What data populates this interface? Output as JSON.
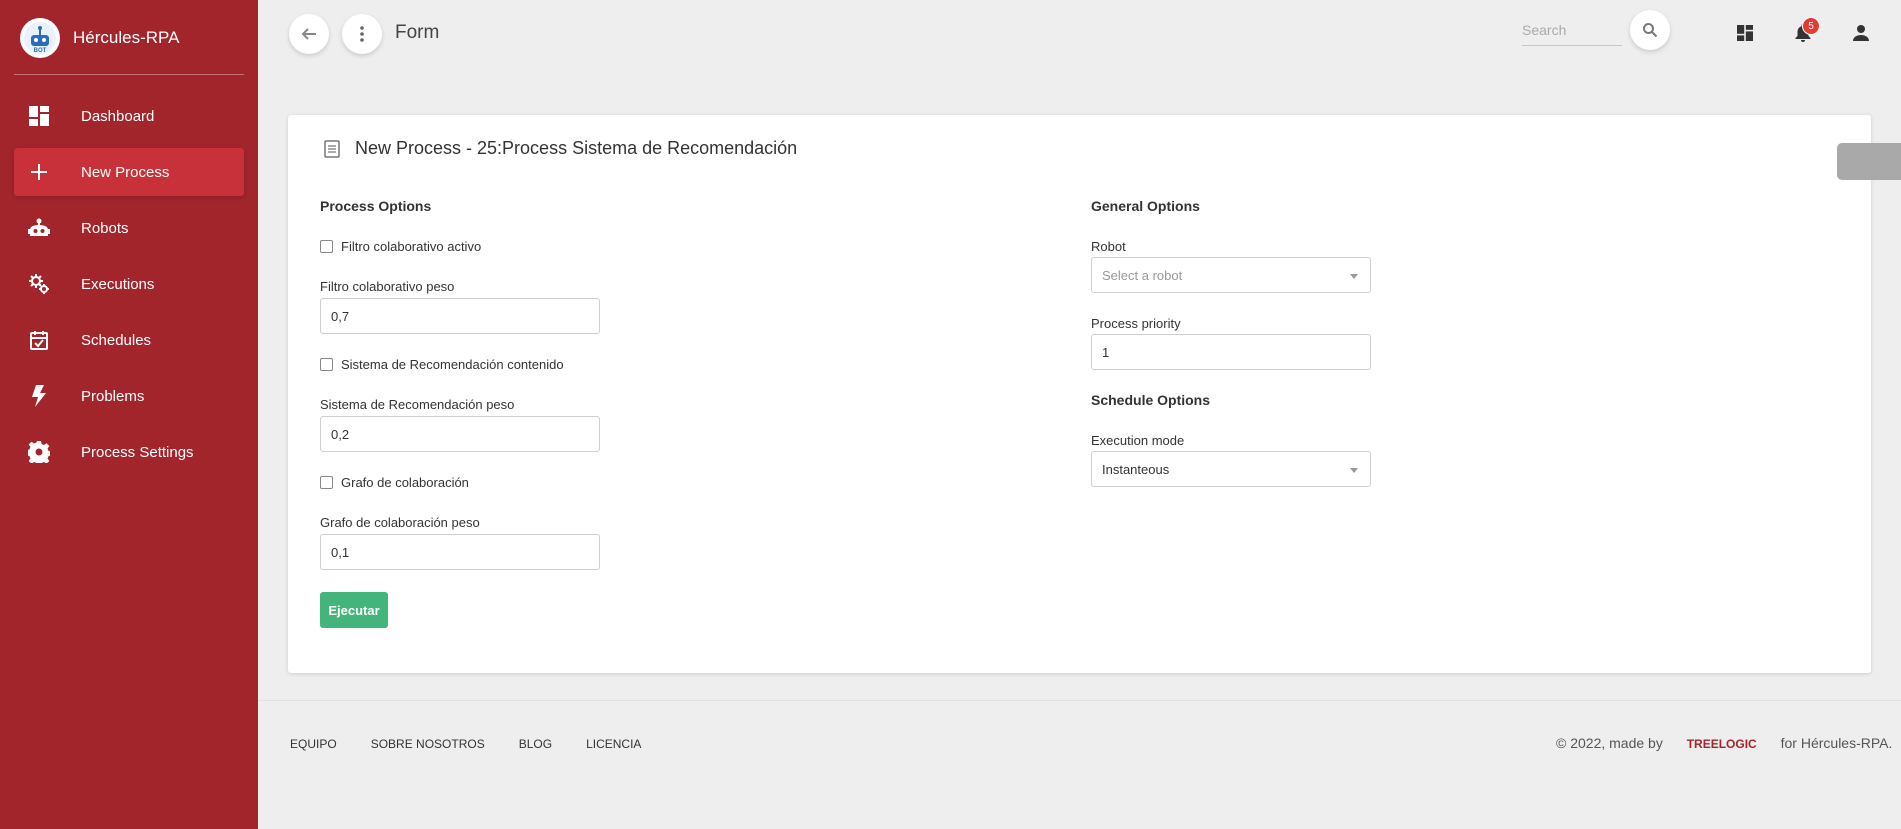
{
  "app": {
    "name": "Hércules-RPA"
  },
  "sidebar": {
    "items": [
      {
        "label": "Dashboard",
        "icon": "dashboard-icon",
        "active": false
      },
      {
        "label": "New Process",
        "icon": "plus-icon",
        "active": true
      },
      {
        "label": "Robots",
        "icon": "robot-icon",
        "active": false
      },
      {
        "label": "Executions",
        "icon": "gears-icon",
        "active": false
      },
      {
        "label": "Schedules",
        "icon": "calendar-check-icon",
        "active": false
      },
      {
        "label": "Problems",
        "icon": "lightning-icon",
        "active": false
      },
      {
        "label": "Process Settings",
        "icon": "settings-icon",
        "active": false
      }
    ]
  },
  "header": {
    "title": "Form",
    "search_placeholder": "Search",
    "notification_count": "5"
  },
  "card": {
    "title": "New Process - 25:Process Sistema de Recomendación",
    "process_options": {
      "title": "Process Options",
      "cb1_label": "Filtro colaborativo activo",
      "field1_label": "Filtro colaborativo peso",
      "field1_value": "0,7",
      "cb2_label": "Sistema de Recomendación contenido",
      "field2_label": "Sistema de Recomendación peso",
      "field2_value": "0,2",
      "cb3_label": "Grafo de colaboración",
      "field3_label": "Grafo de colaboración peso",
      "field3_value": "0,1",
      "submit_label": "Ejecutar"
    },
    "general_options": {
      "title": "General Options",
      "robot_label": "Robot",
      "robot_placeholder": "Select a robot",
      "priority_label": "Process priority",
      "priority_value": "1"
    },
    "schedule_options": {
      "title": "Schedule Options",
      "mode_label": "Execution mode",
      "mode_value": "Instanteous"
    }
  },
  "footer": {
    "links": [
      "EQUIPO",
      "SOBRE NOSOTROS",
      "BLOG",
      "LICENCIA"
    ],
    "copyright_prefix": "© 2022, made by",
    "brand": "TREELOGIC",
    "copyright_suffix": "for Hércules-RPA."
  },
  "colors": {
    "sidebar": "#a2252c",
    "active_item": "#c8313a",
    "submit": "#43b47c",
    "badge": "#e53935"
  }
}
